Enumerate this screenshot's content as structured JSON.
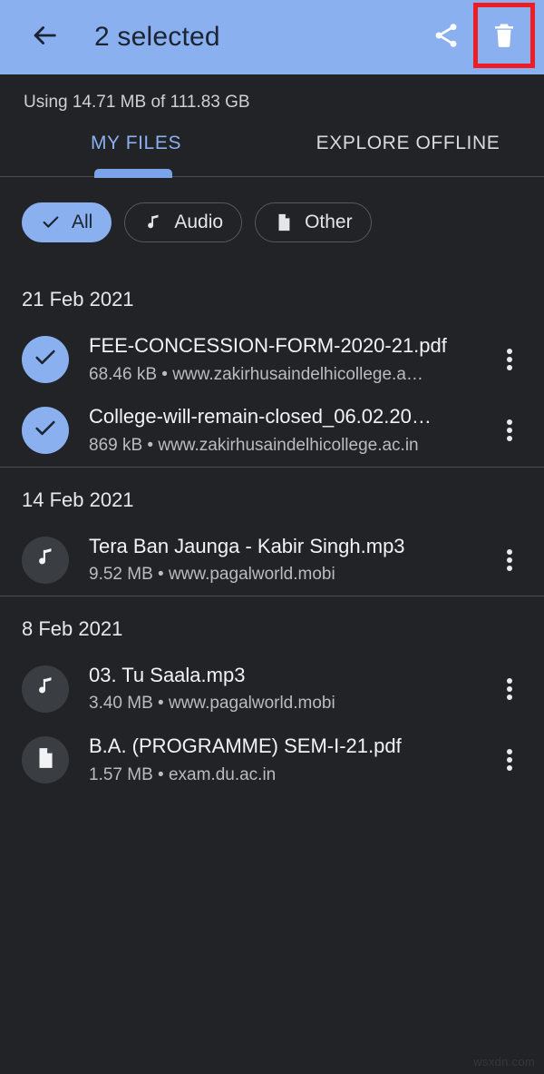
{
  "appbar": {
    "back_icon": "arrow-back-icon",
    "title": "2 selected",
    "share_icon": "share-icon",
    "delete_icon": "delete-trash-icon",
    "background_color": "#8ab0f0",
    "highlight_color": "#ee1c24"
  },
  "storage": {
    "text": "Using 14.71 MB of 111.83 GB"
  },
  "tabs": {
    "items": [
      {
        "label": "MY FILES",
        "active": true
      },
      {
        "label": "EXPLORE OFFLINE",
        "active": false
      }
    ],
    "indicator_color": "#7ba4e8"
  },
  "chips": [
    {
      "label": "All",
      "icon": "check-icon",
      "selected": true
    },
    {
      "label": "Audio",
      "icon": "music-note-icon",
      "selected": false
    },
    {
      "label": "Other",
      "icon": "document-icon",
      "selected": false
    }
  ],
  "groups": [
    {
      "date": "21 Feb 2021",
      "files": [
        {
          "name": "FEE-CONCESSION-FORM-2020-21.pdf",
          "meta": "68.46 kB • www.zakirhusaindelhicollege.a…",
          "icon": "check-icon",
          "selected": true,
          "more_icon": "more-vertical-icon"
        },
        {
          "name": "College-will-remain-closed_06.02.20…",
          "meta": "869 kB • www.zakirhusaindelhicollege.ac.in",
          "icon": "check-icon",
          "selected": true,
          "more_icon": "more-vertical-icon"
        }
      ]
    },
    {
      "date": "14 Feb 2021",
      "files": [
        {
          "name": "Tera Ban Jaunga - Kabir Singh.mp3",
          "meta": "9.52 MB • www.pagalworld.mobi",
          "icon": "music-note-icon",
          "selected": false,
          "more_icon": "more-vertical-icon"
        }
      ]
    },
    {
      "date": "8 Feb 2021",
      "files": [
        {
          "name": "03. Tu Saala.mp3",
          "meta": "3.40 MB • www.pagalworld.mobi",
          "icon": "music-note-icon",
          "selected": false,
          "more_icon": "more-vertical-icon"
        },
        {
          "name": "B.A. (PROGRAMME) SEM-I-21.pdf",
          "meta": "1.57 MB • exam.du.ac.in",
          "icon": "document-icon",
          "selected": false,
          "more_icon": "more-vertical-icon"
        }
      ]
    }
  ],
  "watermark": {
    "text": "wsxdn.com"
  }
}
